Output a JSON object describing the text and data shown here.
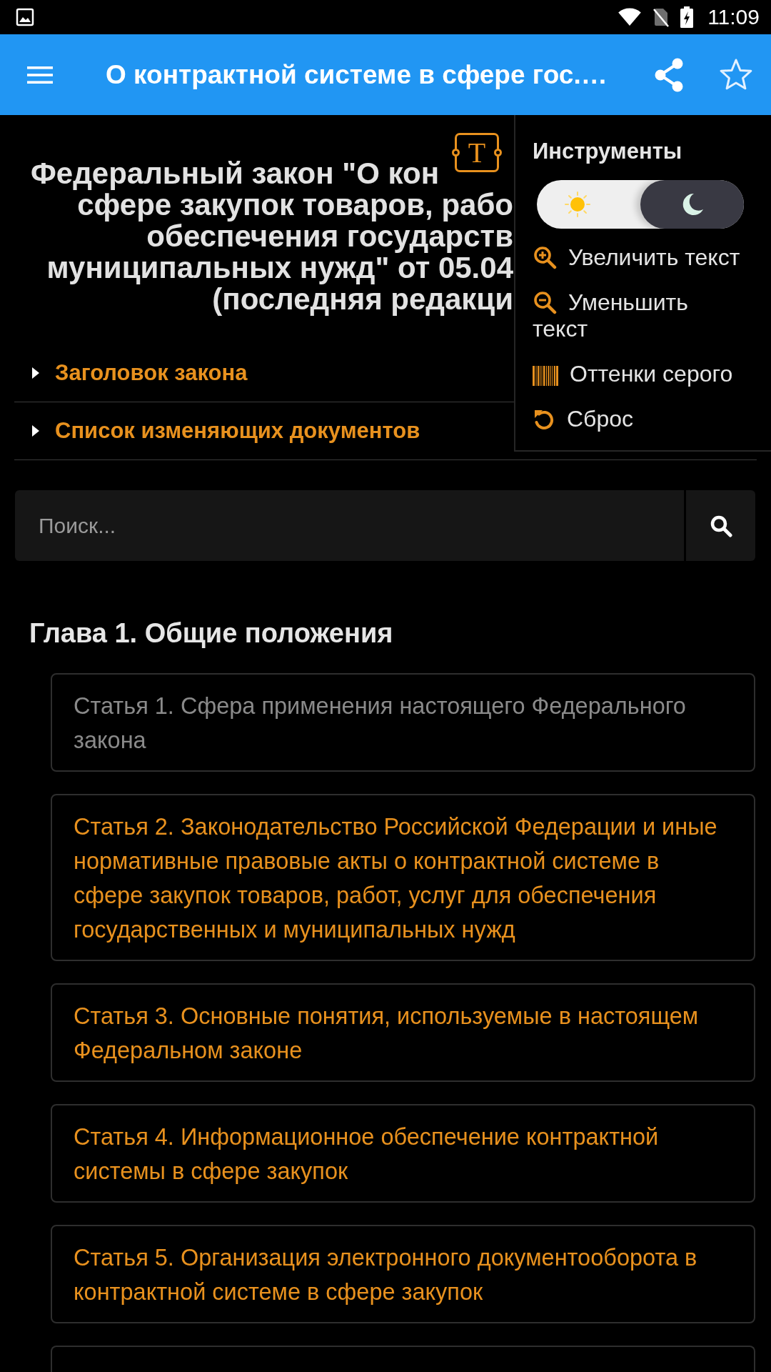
{
  "status_bar": {
    "time": "11:09"
  },
  "app_bar": {
    "title": "О контрактной системе в сфере гос.…",
    "bookmarked": false
  },
  "document": {
    "title_lines": [
      "Федеральный закон \"О кон",
      "сфере закупок товаров, рабо",
      "обеспечения государств",
      "муниципальных нужд\" от 05.04",
      "(последняя редакци"
    ],
    "text_tools_button": {
      "label": "T"
    }
  },
  "tools_menu": {
    "title": "Инструменты",
    "dark_mode": true,
    "items": [
      {
        "kind": "zoom_in",
        "label": "Увеличить текст"
      },
      {
        "kind": "zoom_out",
        "label": "Уменьшить текст"
      },
      {
        "kind": "grayscale",
        "label": "Оттенки серого"
      },
      {
        "kind": "reset",
        "label": "Сброс"
      }
    ]
  },
  "sections": [
    {
      "label": "Заголовок закона",
      "expanded": false
    },
    {
      "label": "Список изменяющих документов",
      "expanded": false
    }
  ],
  "search": {
    "placeholder": "Поиск..."
  },
  "chapter": {
    "title": "Глава 1. Общие положения",
    "articles": [
      {
        "kind": "article",
        "title": "Статья 1. Сфера применения настоящего Федерального закона",
        "visited": true
      },
      {
        "kind": "article",
        "title": "Статья 2. Законодательство Российской Федерации и иные нормативные правовые акты о контрактной системе в сфере закупок товаров, работ, услуг для обеспечения государственных и муниципальных нужд",
        "visited": false
      },
      {
        "kind": "article",
        "title": "Статья 3. Основные понятия, используемые в настоящем Федеральном законе",
        "visited": false
      },
      {
        "kind": "article",
        "title": "Статья 4. Информационное обеспечение контрактной системы в сфере закупок",
        "visited": false
      },
      {
        "kind": "article",
        "title": "Статья 5. Организация электронного документооборота в контрактной системе в сфере закупок",
        "visited": false
      },
      {
        "kind": "cut"
      }
    ]
  }
}
